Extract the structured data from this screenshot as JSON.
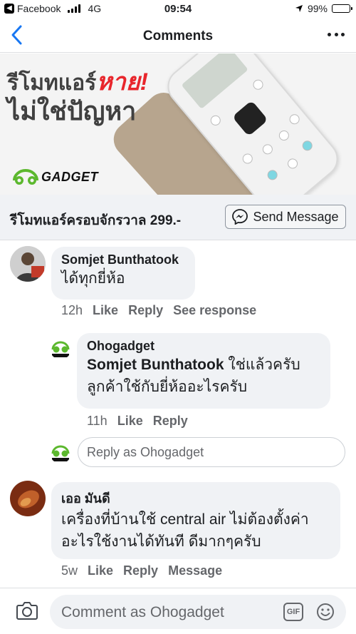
{
  "status_bar": {
    "back_app": "Facebook",
    "network": "4G",
    "time": "09:54",
    "battery": "99%",
    "battery_level": 0.99
  },
  "nav": {
    "title": "Comments"
  },
  "ad": {
    "headline_part1": "รีโมทแอร์",
    "headline_highlight": "หาย!",
    "headline_line2": "ไม่ใช่ปัญหา",
    "logo_text": "GADGET",
    "caption": "รีโมทแอร์ครอบจักรวาล 299.-",
    "send_message_label": "Send Message"
  },
  "comments": [
    {
      "author": "Somjet Bunthatook",
      "text": "ได้ทุกยี่ห้อ",
      "time": "12h",
      "actions": [
        "Like",
        "Reply",
        "See response"
      ]
    },
    {
      "author": "Ohogadget",
      "mention": "Somjet Bunthatook",
      "text_after_mention": " ใช่แล้วครับ",
      "text_line2": "ลูกค้าใช้กับยี่ห้ออะไรครับ",
      "time": "11h",
      "actions": [
        "Like",
        "Reply"
      ]
    },
    {
      "author": "เออ มันดี",
      "text_line1": "เครื่องที่บ้านใช้ central air ไม่ต้องตั้งค่า",
      "text_line2": "อะไรใช้งานได้ทันที ดีมากๆครับ",
      "time": "5w",
      "actions": [
        "Like",
        "Reply",
        "Message"
      ]
    }
  ],
  "reply_box": {
    "placeholder": "Reply as Ohogadget"
  },
  "composer": {
    "placeholder": "Comment as Ohogadget",
    "gif_label": "GIF"
  },
  "colors": {
    "brand_blue": "#1877f2",
    "ad_red": "#e8262c",
    "logo_green": "#5cb82e"
  }
}
